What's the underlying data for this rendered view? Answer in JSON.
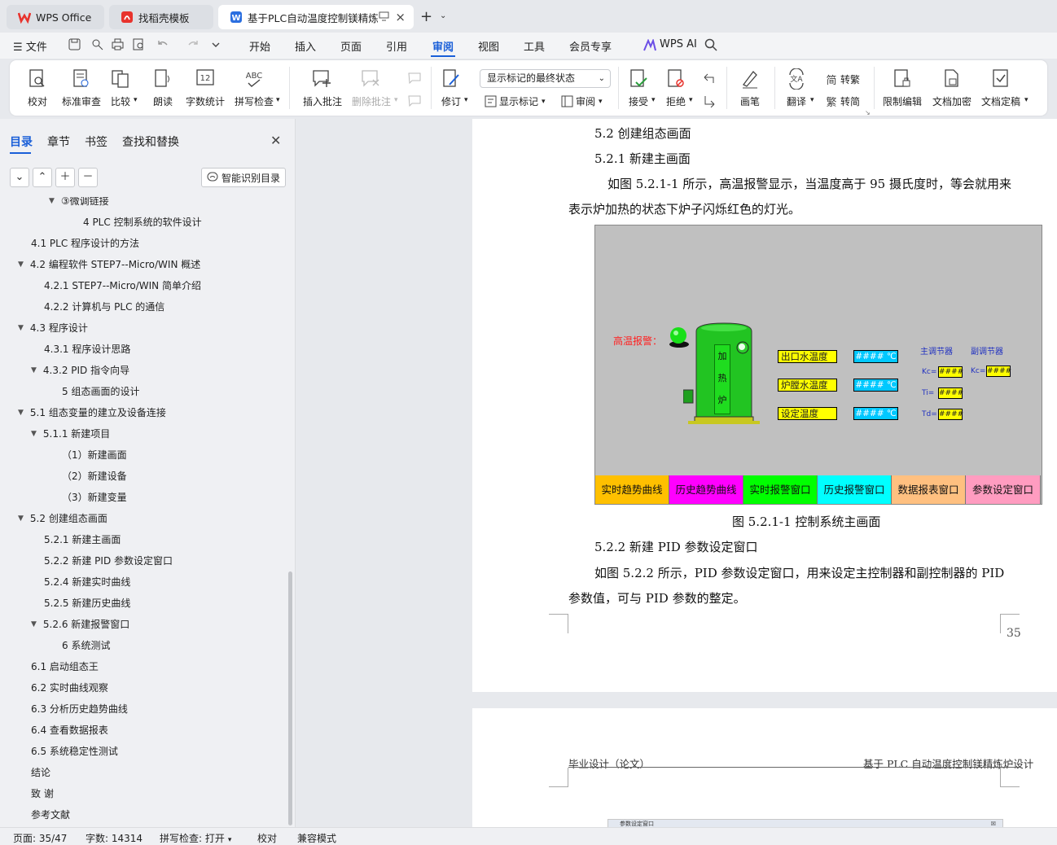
{
  "tabs": [
    {
      "label": "WPS Office",
      "icon": "wps-logo-icon"
    },
    {
      "label": "找稻壳模板",
      "icon": "docer-icon"
    },
    {
      "label": "基于PLC自动温度控制镁精炼炉",
      "icon": "word-doc-icon"
    }
  ],
  "menu": {
    "file": "文件",
    "items": [
      "开始",
      "插入",
      "页面",
      "引用",
      "审阅",
      "视图",
      "工具",
      "会员专享"
    ],
    "ai": "WPS AI"
  },
  "ribbon": {
    "proofread": "校对",
    "std_review": "标准审查",
    "compare": "比较",
    "read_aloud": "朗读",
    "word_count": "字数统计",
    "spell_check": "拼写检查",
    "insert_comment": "插入批注",
    "delete_comment": "删除批注",
    "revise": "修订",
    "mark_state": "显示标记的最终状态",
    "show_marks": "显示标记",
    "review_pane": "审阅",
    "accept": "接受",
    "reject": "拒绝",
    "pen": "画笔",
    "translate": "翻译",
    "to_trad": "转繁",
    "to_simp": "转简",
    "restrict_edit": "限制编辑",
    "encrypt": "文档加密",
    "finalize": "文档定稿"
  },
  "sidebar": {
    "tabs": [
      "目录",
      "章节",
      "书签",
      "查找和替换"
    ],
    "smart_btn": "智能识别目录",
    "toc": [
      {
        "text": "③微调链接",
        "level": 3,
        "arrow": true
      },
      {
        "text": "4   PLC 控制系统的软件设计",
        "level": 4,
        "arrow": false
      },
      {
        "text": "4.1   PLC 程序设计的方法",
        "level": 1,
        "arrow": false
      },
      {
        "text": "4.2   编程软件 STEP7--Micro/WIN  概述",
        "level": 1,
        "arrow": true
      },
      {
        "text": "4.2.1   STEP7--Micro/WIN  简单介绍",
        "level": 2,
        "arrow": false
      },
      {
        "text": "4.2.2   计算机与 PLC 的通信",
        "level": 2,
        "arrow": false
      },
      {
        "text": "4.3   程序设计",
        "level": 1,
        "arrow": true
      },
      {
        "text": "4.3.1   程序设计思路",
        "level": 2,
        "arrow": false
      },
      {
        "text": "4.3.2   PID 指令向导",
        "level": 2,
        "arrow": true
      },
      {
        "text": "5   组态画面的设计",
        "level": 3,
        "arrow": false
      },
      {
        "text": "5.1   组态变量的建立及设备连接",
        "level": 1,
        "arrow": true
      },
      {
        "text": "5.1.1   新建项目",
        "level": 2,
        "arrow": true
      },
      {
        "text": "（1）新建画面",
        "level": 3,
        "arrow": false
      },
      {
        "text": "（2）新建设备",
        "level": 3,
        "arrow": false
      },
      {
        "text": "（3）新建变量",
        "level": 3,
        "arrow": false
      },
      {
        "text": "5.2   创建组态画面",
        "level": 1,
        "arrow": true
      },
      {
        "text": "5.2.1   新建主画面",
        "level": 2,
        "arrow": false
      },
      {
        "text": "5.2.2  新建 PID 参数设定窗口",
        "level": 2,
        "arrow": false
      },
      {
        "text": "5.2.4  新建实时曲线",
        "level": 2,
        "arrow": false
      },
      {
        "text": "5.2.5  新建历史曲线",
        "level": 2,
        "arrow": false
      },
      {
        "text": "5.2.6  新建报警窗口",
        "level": 2,
        "arrow": true
      },
      {
        "text": "6    系统测试",
        "level": 3,
        "arrow": false
      },
      {
        "text": "6.1   启动组态王",
        "level": 1,
        "arrow": false
      },
      {
        "text": "6.2   实时曲线观察",
        "level": 1,
        "arrow": false
      },
      {
        "text": "6.3   分析历史趋势曲线",
        "level": 1,
        "arrow": false
      },
      {
        "text": "6.4   查看数据报表",
        "level": 1,
        "arrow": false
      },
      {
        "text": "6.5  系统稳定性测试",
        "level": 1,
        "arrow": false
      },
      {
        "text": "结论",
        "level": 1,
        "arrow": false
      },
      {
        "text": "致   谢",
        "level": 1,
        "arrow": false
      },
      {
        "text": "参考文献",
        "level": 1,
        "arrow": false
      }
    ]
  },
  "doc": {
    "h52": "5.2   创建组态画面",
    "h521": "5.2.1    新建主画面",
    "para1_l1": "如图 5.2.1-1 所示，高温报警显示，当温度高于 95 摄氏度时，等会就用来",
    "para1_l2": "表示炉加热的状态下炉子闪烁红色的灯光。",
    "fig_caption": "图 5.2.1-1  控制系统主画面",
    "h522": "5.2.2  新建 PID 参数设定窗口",
    "para2_l1": "如图 5.2.2 所示，PID 参数设定窗口，用来设定主控制器和副控制器的 PID",
    "para2_l2": "参数值，可与 PID 参数的整定。",
    "page_num": "35",
    "header_left": "毕业设计（论文）",
    "header_right": "基于 PLC 自动温度控制镁精炼炉设计",
    "fig2_title": "参数设定窗口"
  },
  "scada": {
    "alarm": "高温报警：",
    "furnace": [
      "加",
      "热",
      "炉"
    ],
    "labels": [
      "出口水温度",
      "炉膛水温度",
      "设定温度"
    ],
    "values": [
      "#### ℃",
      "#### ℃",
      "#### ℃"
    ],
    "main_ctrl": "主调节器",
    "sub_ctrl": "副调节器",
    "kc": "Kc=",
    "ti": "Ti=",
    "td": "Td=",
    "pv": "####",
    "buttons": [
      {
        "label": "实时趋势曲线",
        "color": "#ffc000"
      },
      {
        "label": "历史趋势曲线",
        "color": "#ff00ff"
      },
      {
        "label": "实时报警窗口",
        "color": "#00ff00"
      },
      {
        "label": "历史报警窗口",
        "color": "#00ffff"
      },
      {
        "label": "数据报表窗口",
        "color": "#ffc080"
      },
      {
        "label": "参数设定窗口",
        "color": "#ff9cc0"
      }
    ]
  },
  "status": {
    "page": "页面: 35/47",
    "words": "字数: 14314",
    "spell": "拼写检查: 打开",
    "proof": "校对",
    "compat": "兼容模式"
  },
  "colors": {
    "accent": "#1a5fd8",
    "wps_red": "#e8332d"
  }
}
